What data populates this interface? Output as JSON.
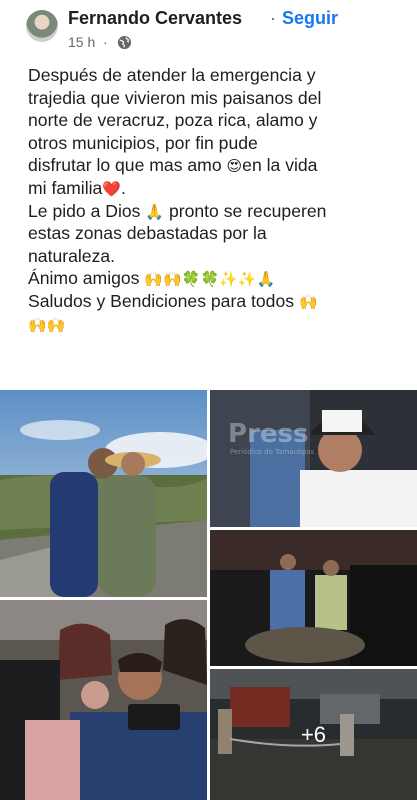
{
  "post": {
    "author": "Fernando Cervantes",
    "separator": "·",
    "follow_label": "Seguir",
    "time": "15 h",
    "time_separator": "·",
    "privacy_icon": "globe-icon",
    "lines": [
      "Después de atender la emergencia y",
      "trajedia que vivieron mis paisanos del",
      "norte de  veracruz,  poza rica, alamo y",
      "otros municipios, por fin pude",
      "disfrutar lo que mas amo",
      "en la vida",
      "mi familia",
      "Le pido a Dios",
      "pronto se recuperen",
      "estas zonas debastadas por la",
      "naturaleza.",
      "Ánimo amigos",
      "Saludos y Bendiciones para todos"
    ],
    "emojis": {
      "heart_eyes": "😍",
      "heart": "❤️",
      "pray": "🙏",
      "raised_hands": "🙌",
      "clover": "🍀",
      "sparkles": "✨"
    }
  },
  "photos": {
    "watermark": "Press",
    "watermark_sub": "Periódico de Tamaulipas",
    "more_count": "+6"
  }
}
